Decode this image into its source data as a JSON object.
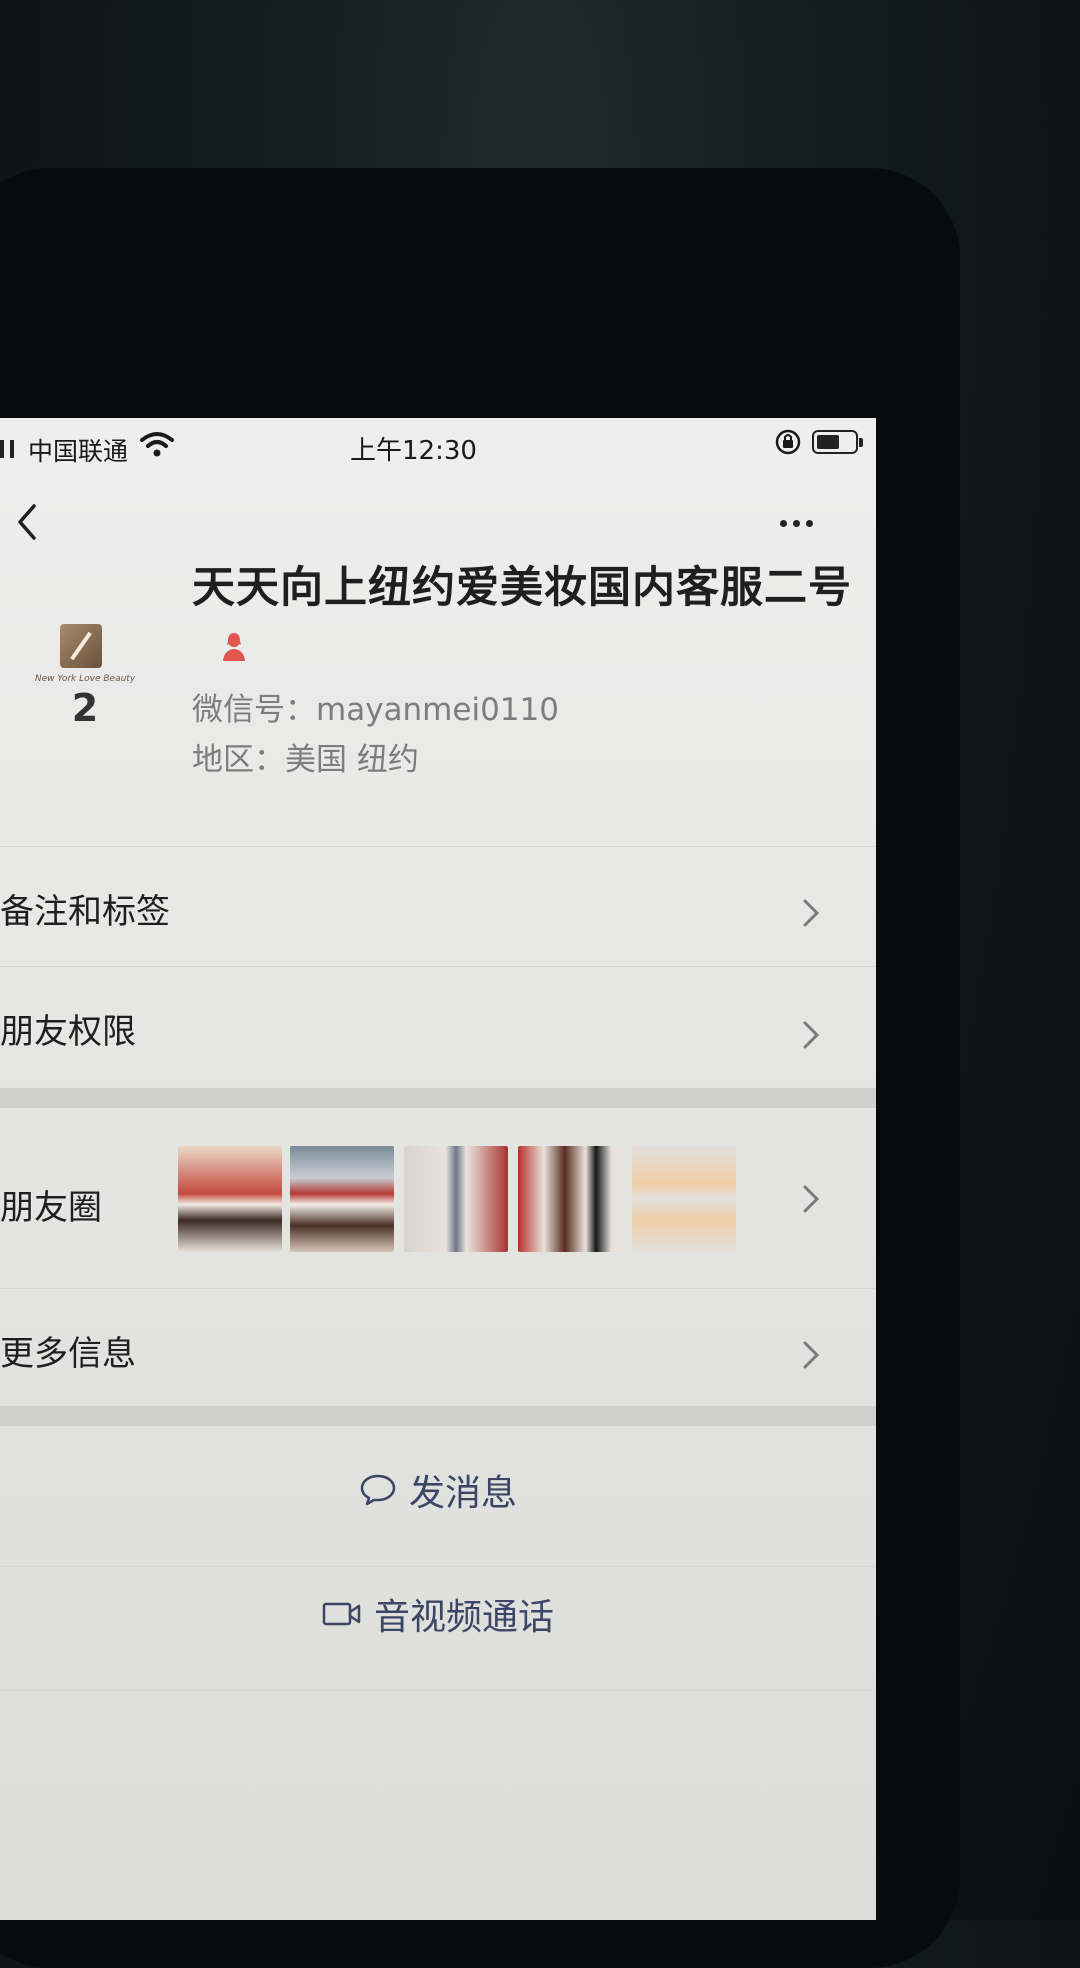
{
  "status_bar": {
    "carrier": "中国联通",
    "time": "上午12:30",
    "battery_level": 0.6
  },
  "profile": {
    "name": "天天向上纽约爱美妆国内客服二号",
    "avatar_number": "2",
    "avatar_brand": "New York Love Beauty",
    "wechat_id": "微信号：mayanmei0110",
    "region": "地区：美国 纽约",
    "gender_icon": "female-icon",
    "gender_color": "#e0574f"
  },
  "menu": {
    "remarks": "备注和标签",
    "friend_permissions": "朋友权限",
    "moments": "朋友圈",
    "more_info": "更多信息"
  },
  "actions": {
    "message": "发消息",
    "call": "音视频通话"
  },
  "colors": {
    "accent": "#3b4565",
    "background": "#ededed"
  }
}
